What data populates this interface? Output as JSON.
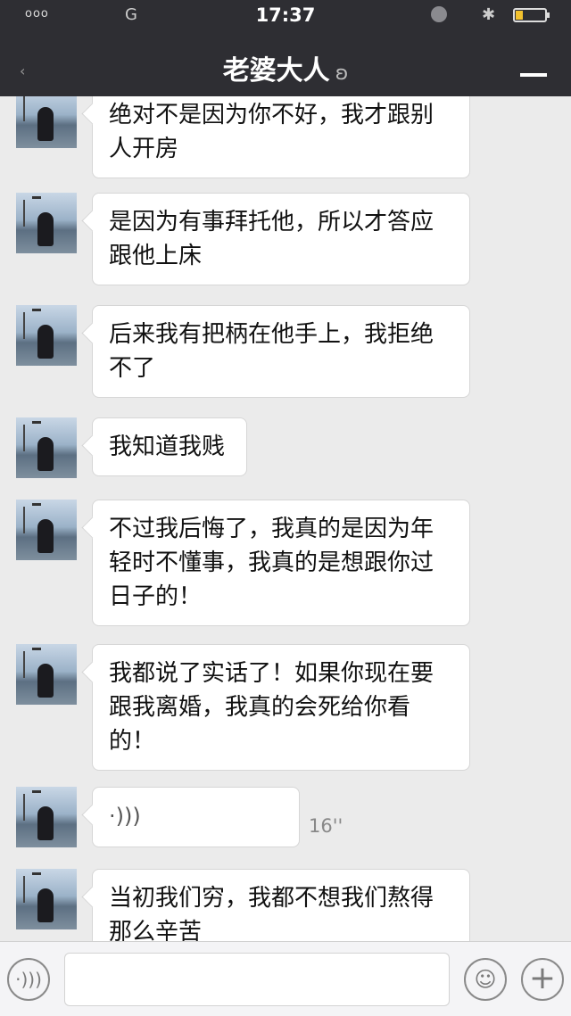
{
  "status_bar": {
    "signal": "ooo",
    "carrier": "G",
    "time": "17:37"
  },
  "nav": {
    "title": "老婆大人",
    "ear_icon": "ear-icon",
    "menu_icon": "menu-icon"
  },
  "messages": [
    {
      "type": "text",
      "text": "绝对不是因为你不好，我才跟别人开房",
      "lines": [
        "绝对不是因为你不好，我才跟别",
        "人开房"
      ]
    },
    {
      "type": "text",
      "lines": [
        "是因为有事拜托他，所以才答应",
        "跟他上床"
      ]
    },
    {
      "type": "text",
      "lines": [
        "后来我有把柄在他手上，我拒绝",
        "不了"
      ]
    },
    {
      "type": "text",
      "lines": [
        "我知道我贱"
      ]
    },
    {
      "type": "text",
      "lines": [
        "不过我后悔了，我真的是因为年",
        "轻时不懂事，我真的是想跟你过",
        "日子的！"
      ]
    },
    {
      "type": "text",
      "lines": [
        "我都说了实话了！如果你现在要",
        "跟我离婚，我真的会死给你看",
        "的！"
      ]
    },
    {
      "type": "voice",
      "icon": "voice-wave-icon",
      "duration": "16''"
    },
    {
      "type": "text",
      "lines": [
        "当初我们穷，我都不想我们熬得",
        "那么辛苦"
      ]
    }
  ],
  "input_bar": {
    "voice_icon": "voice-icon",
    "emoji_icon": "smiley-icon",
    "plus_icon": "plus-icon",
    "input_value": ""
  }
}
